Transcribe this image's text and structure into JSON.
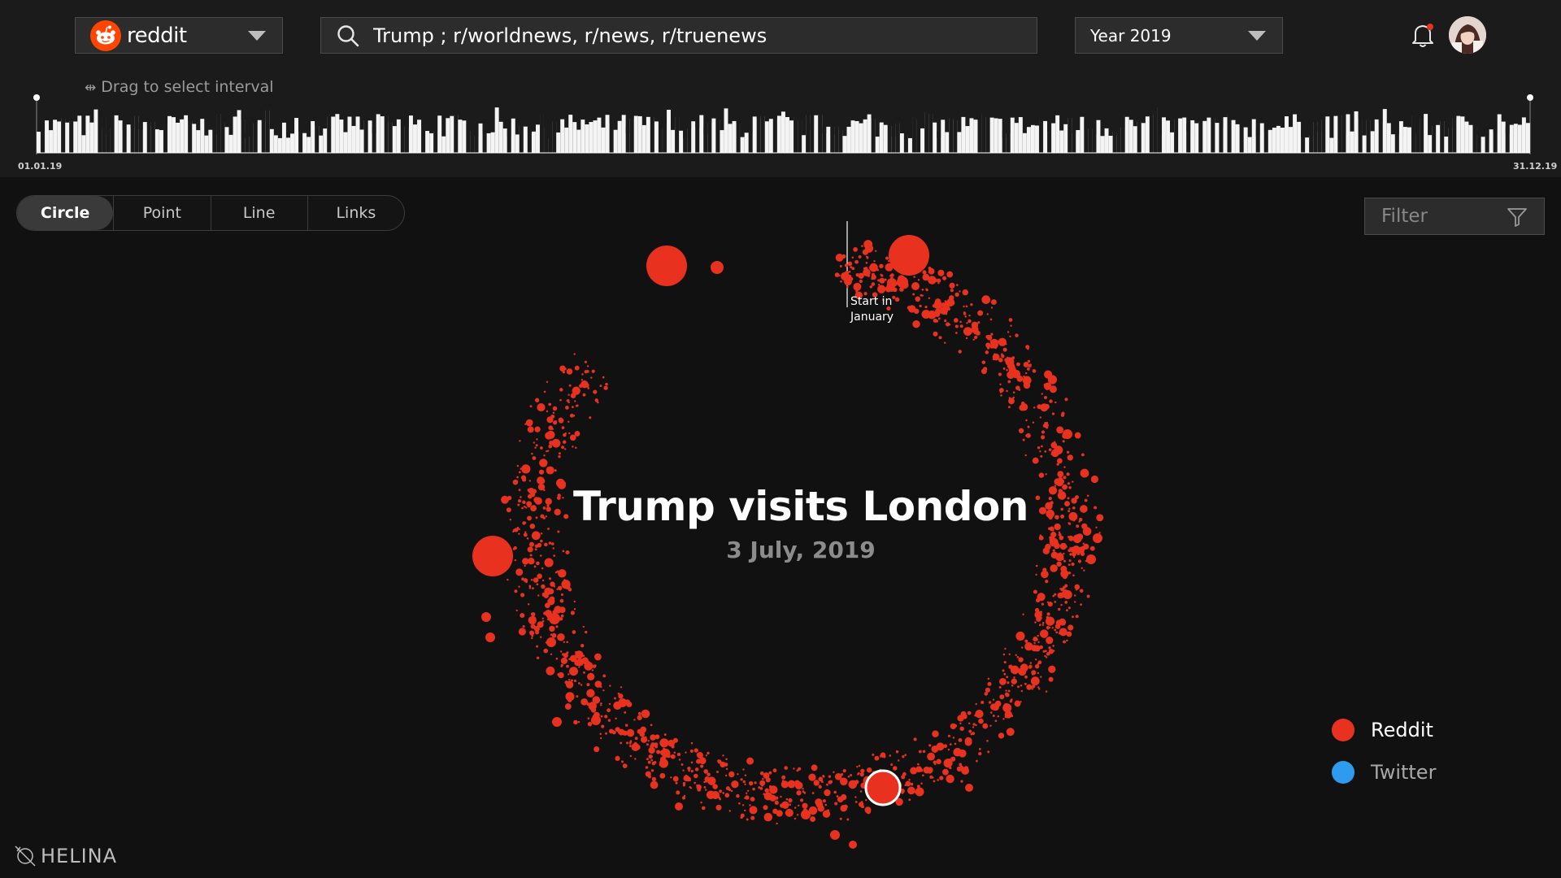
{
  "header": {
    "source": {
      "label": "reddit",
      "icon": "reddit-logo-icon"
    },
    "search": {
      "value": "Trump ; r/worldnews, r/news, r/truenews",
      "placeholder": ""
    },
    "year": {
      "label": "Year 2019"
    },
    "notifications": {
      "icon": "bell-icon",
      "has_unread": true
    }
  },
  "timeline": {
    "hint": "Drag to select interval",
    "start_label": "01.01.19",
    "end_label": "31.12.19",
    "days": 365
  },
  "view_tabs": [
    {
      "label": "Circle",
      "active": true
    },
    {
      "label": "Point",
      "active": false
    },
    {
      "label": "Line",
      "active": false
    },
    {
      "label": "Links",
      "active": false
    }
  ],
  "filter": {
    "placeholder": "Filter",
    "icon": "filter-funnel-icon"
  },
  "visualization": {
    "title": "Trump visits London",
    "date": "3 July, 2019",
    "start_label_line1": "Start in",
    "start_label_line2": "January"
  },
  "legend": [
    {
      "label": "Reddit",
      "color": "#e8321f"
    },
    {
      "label": "Twitter",
      "color": "#2f9bef"
    }
  ],
  "brand_footer": "HELINA",
  "colors": {
    "reddit": "#e8321f",
    "twitter": "#2f9bef",
    "accent": "#ff4500"
  }
}
